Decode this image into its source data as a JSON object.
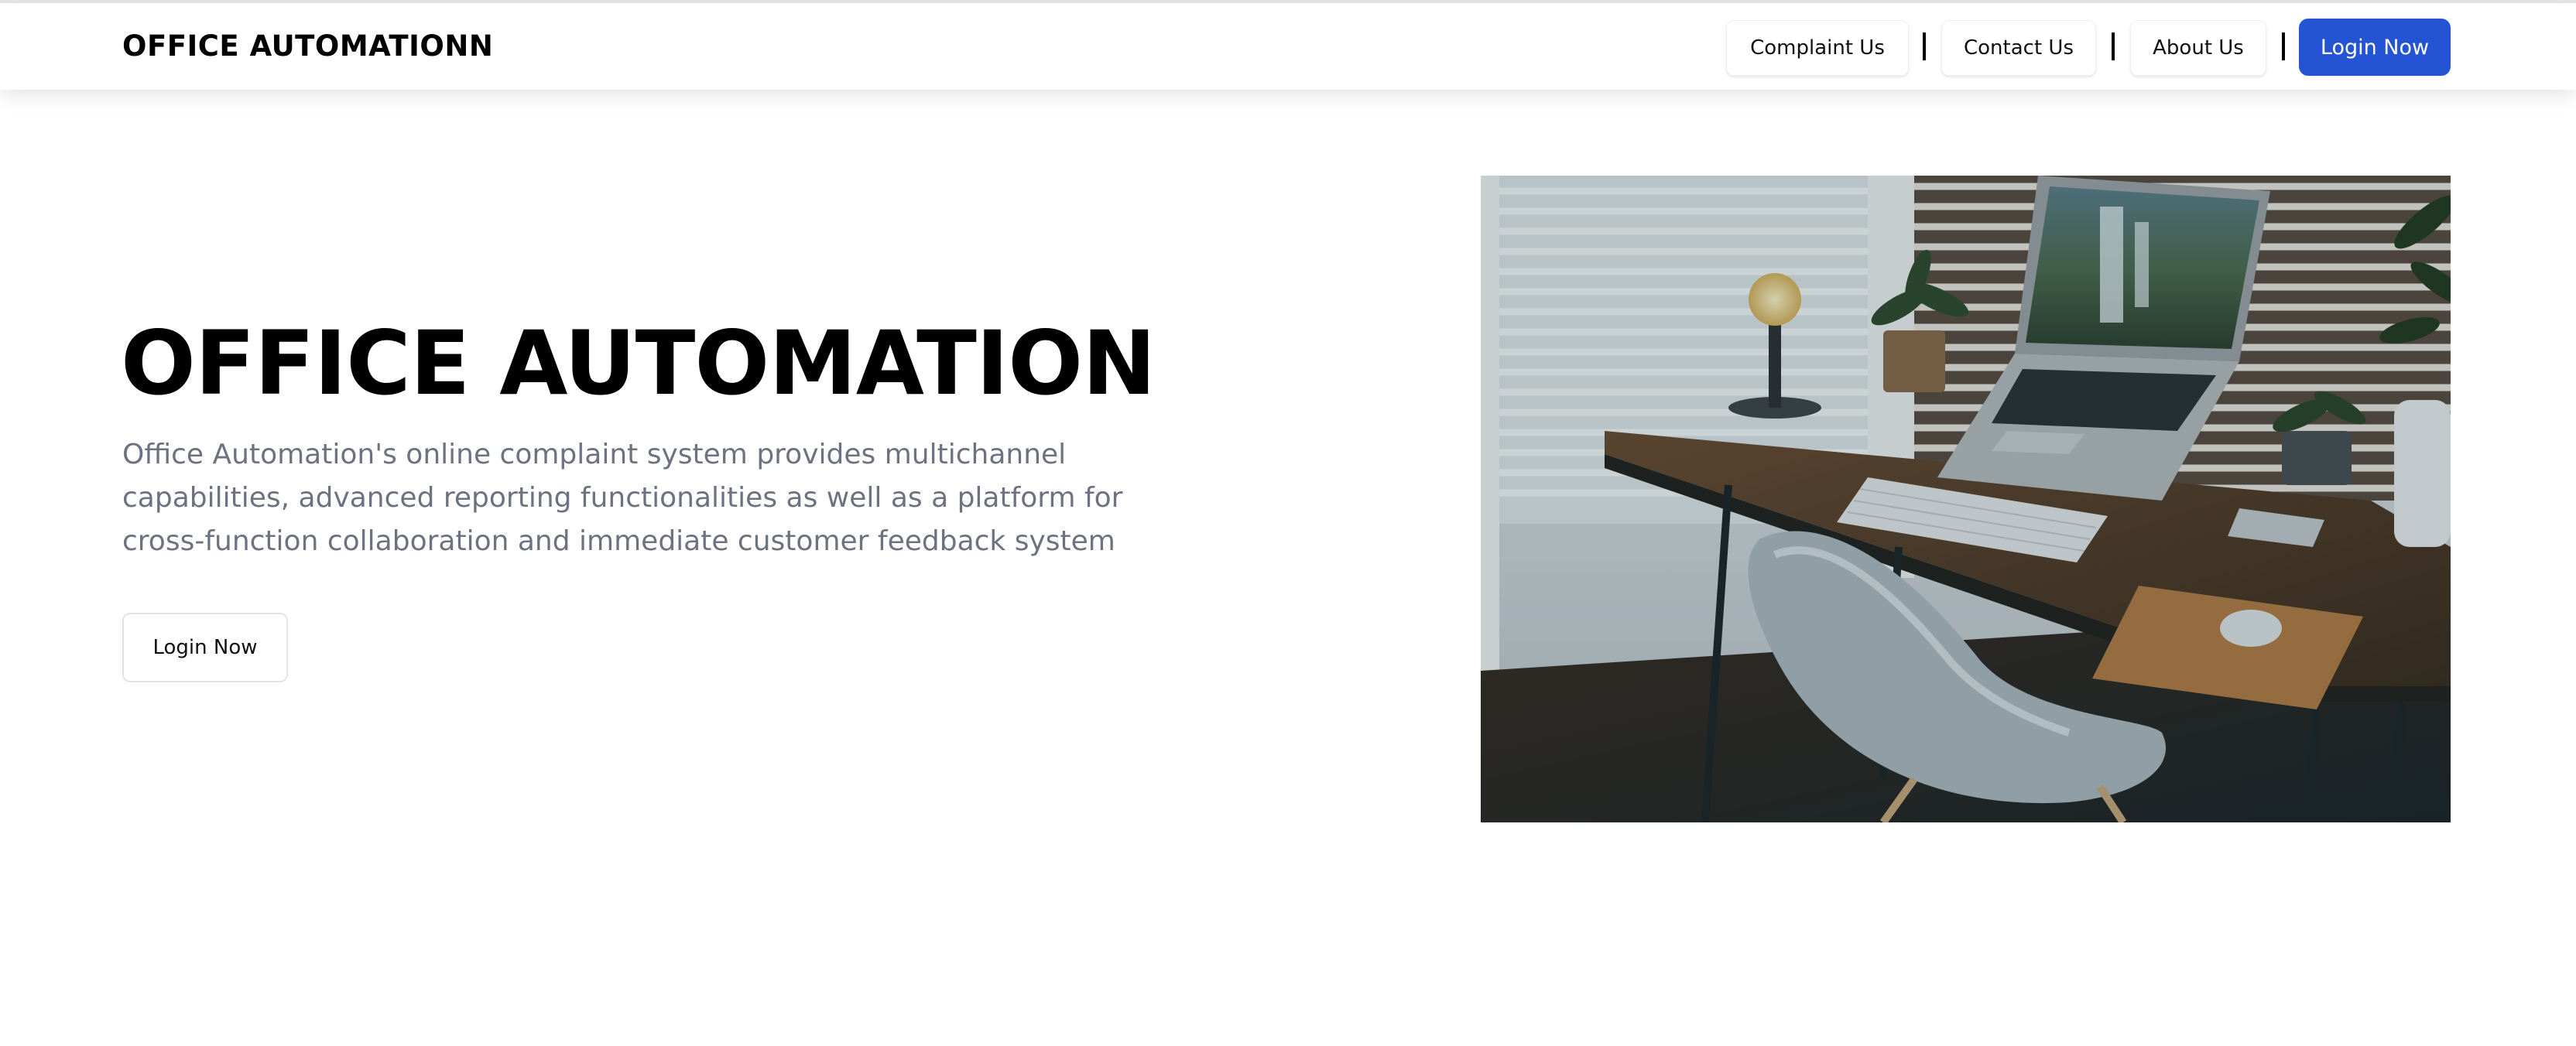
{
  "brand": "OFFICE AUTOMATIONN",
  "nav": {
    "items": [
      {
        "label": "Complaint Us"
      },
      {
        "label": "Contact Us"
      },
      {
        "label": "About Us"
      }
    ],
    "separator": "|",
    "login_label": "Login Now"
  },
  "hero": {
    "title": "OFFICE AUTOMATION",
    "description": "Office Automation's online complaint system provides multichannel capabilities, advanced reporting functionalities as well as a platform for cross-function collaboration and immediate customer feedback system",
    "login_label": "Login Now",
    "image_subject": "office desk with laptop, lamp, keyboard, mouse, plants and white chair by window blinds"
  },
  "colors": {
    "accent": "#2453d4",
    "description_text": "#6c7280",
    "background": "#ffffff"
  }
}
